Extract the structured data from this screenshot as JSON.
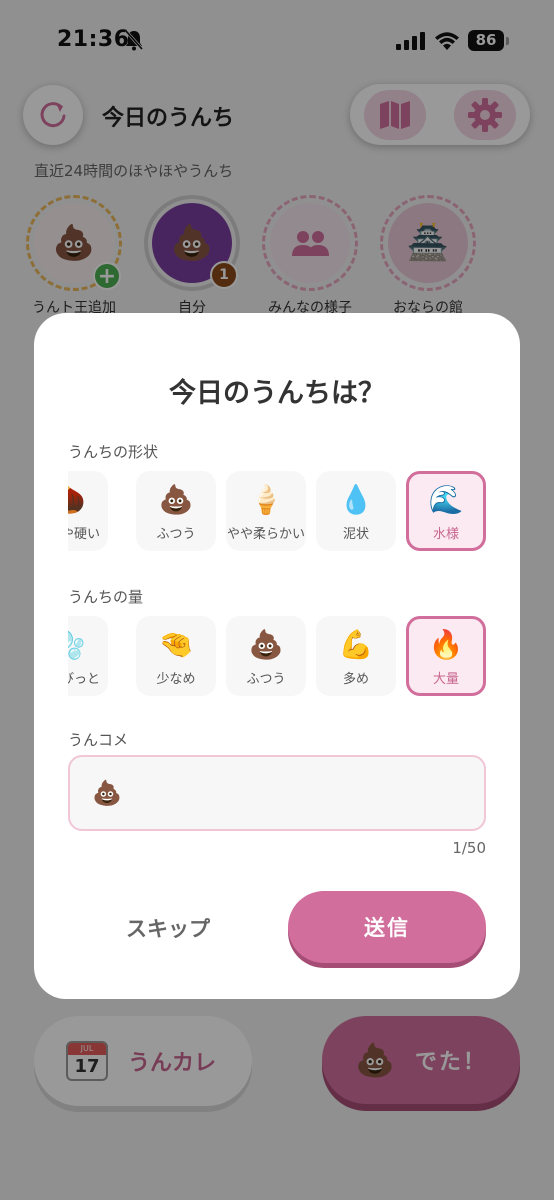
{
  "status_bar": {
    "time": "21:36",
    "battery": "86"
  },
  "header": {
    "title": "今日のうんち",
    "subtitle": "直近24時間のほやほやうんち"
  },
  "stories": [
    {
      "label": "うんト王追加",
      "emoji": "💩",
      "badge": "+"
    },
    {
      "label": "自分",
      "emoji": "💩",
      "badge": "1"
    },
    {
      "label": "みんなの様子",
      "emoji": "",
      "badge": ""
    },
    {
      "label": "おならの館",
      "emoji": "🏯",
      "badge": ""
    }
  ],
  "modal": {
    "title": "今日のうんちは？",
    "shape_section": {
      "label": "うんちの形状",
      "options": [
        {
          "emoji": "🌰",
          "label": "やや硬い",
          "selected": false
        },
        {
          "emoji": "💩",
          "label": "ふつう",
          "selected": false
        },
        {
          "emoji": "🍦",
          "label": "やや柔らかい",
          "selected": false
        },
        {
          "emoji": "💧",
          "label": "泥状",
          "selected": false
        },
        {
          "emoji": "🌊",
          "label": "水様",
          "selected": true
        }
      ]
    },
    "amount_section": {
      "label": "うんちの量",
      "options": [
        {
          "emoji": "🫧",
          "label": "ちょびっと",
          "selected": false
        },
        {
          "emoji": "🤏",
          "label": "少なめ",
          "selected": false
        },
        {
          "emoji": "💩",
          "label": "ふつう",
          "selected": false
        },
        {
          "emoji": "💪",
          "label": "多め",
          "selected": false
        },
        {
          "emoji": "🔥",
          "label": "大量",
          "selected": true
        }
      ]
    },
    "comment": {
      "label": "うんコメ",
      "value": "💩",
      "counter": "1/50"
    },
    "skip_label": "スキップ",
    "send_label": "送信"
  },
  "bottom_bar": {
    "calendar": {
      "month": "JUL",
      "day": "17",
      "label": "うんカレ"
    },
    "poop_button": {
      "emoji": "💩",
      "label": "でた！"
    }
  },
  "colors": {
    "accent": "#d16e9c",
    "accent_dark": "#a64d76",
    "accent_light": "#fbeaf1"
  }
}
